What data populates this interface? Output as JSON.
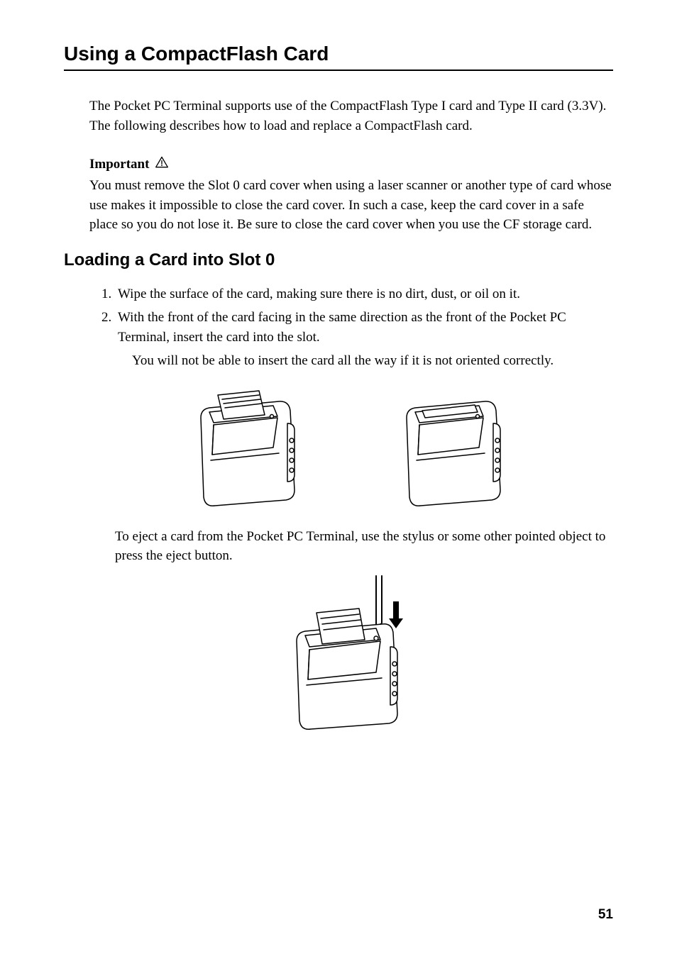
{
  "title": "Using a CompactFlash Card",
  "intro": "The Pocket PC Terminal supports use of the CompactFlash Type I card and Type II card (3.3V). The following describes how to load and replace a CompactFlash card.",
  "important": {
    "label": "Important",
    "text": "You must remove the Slot 0 card cover when using a laser scanner or another type of card whose use makes it impossible to close the card cover. In such a case, keep the card cover in a safe place so you do not lose it. Be sure to close the card cover when you use the CF storage card."
  },
  "subheading": "Loading a Card into Slot 0",
  "steps": [
    "Wipe the surface of the card, making sure there is no dirt, dust, or oil on it.",
    "With the front of the card facing in the same direction as the front of the Pocket PC Terminal, insert the card into the slot."
  ],
  "step2_note": "You will not be able to insert the card all the way if it is not oriented correctly.",
  "eject_text": "To eject a card from the Pocket PC Terminal, use the stylus or some other pointed object to press the eject button.",
  "page_number": "51"
}
